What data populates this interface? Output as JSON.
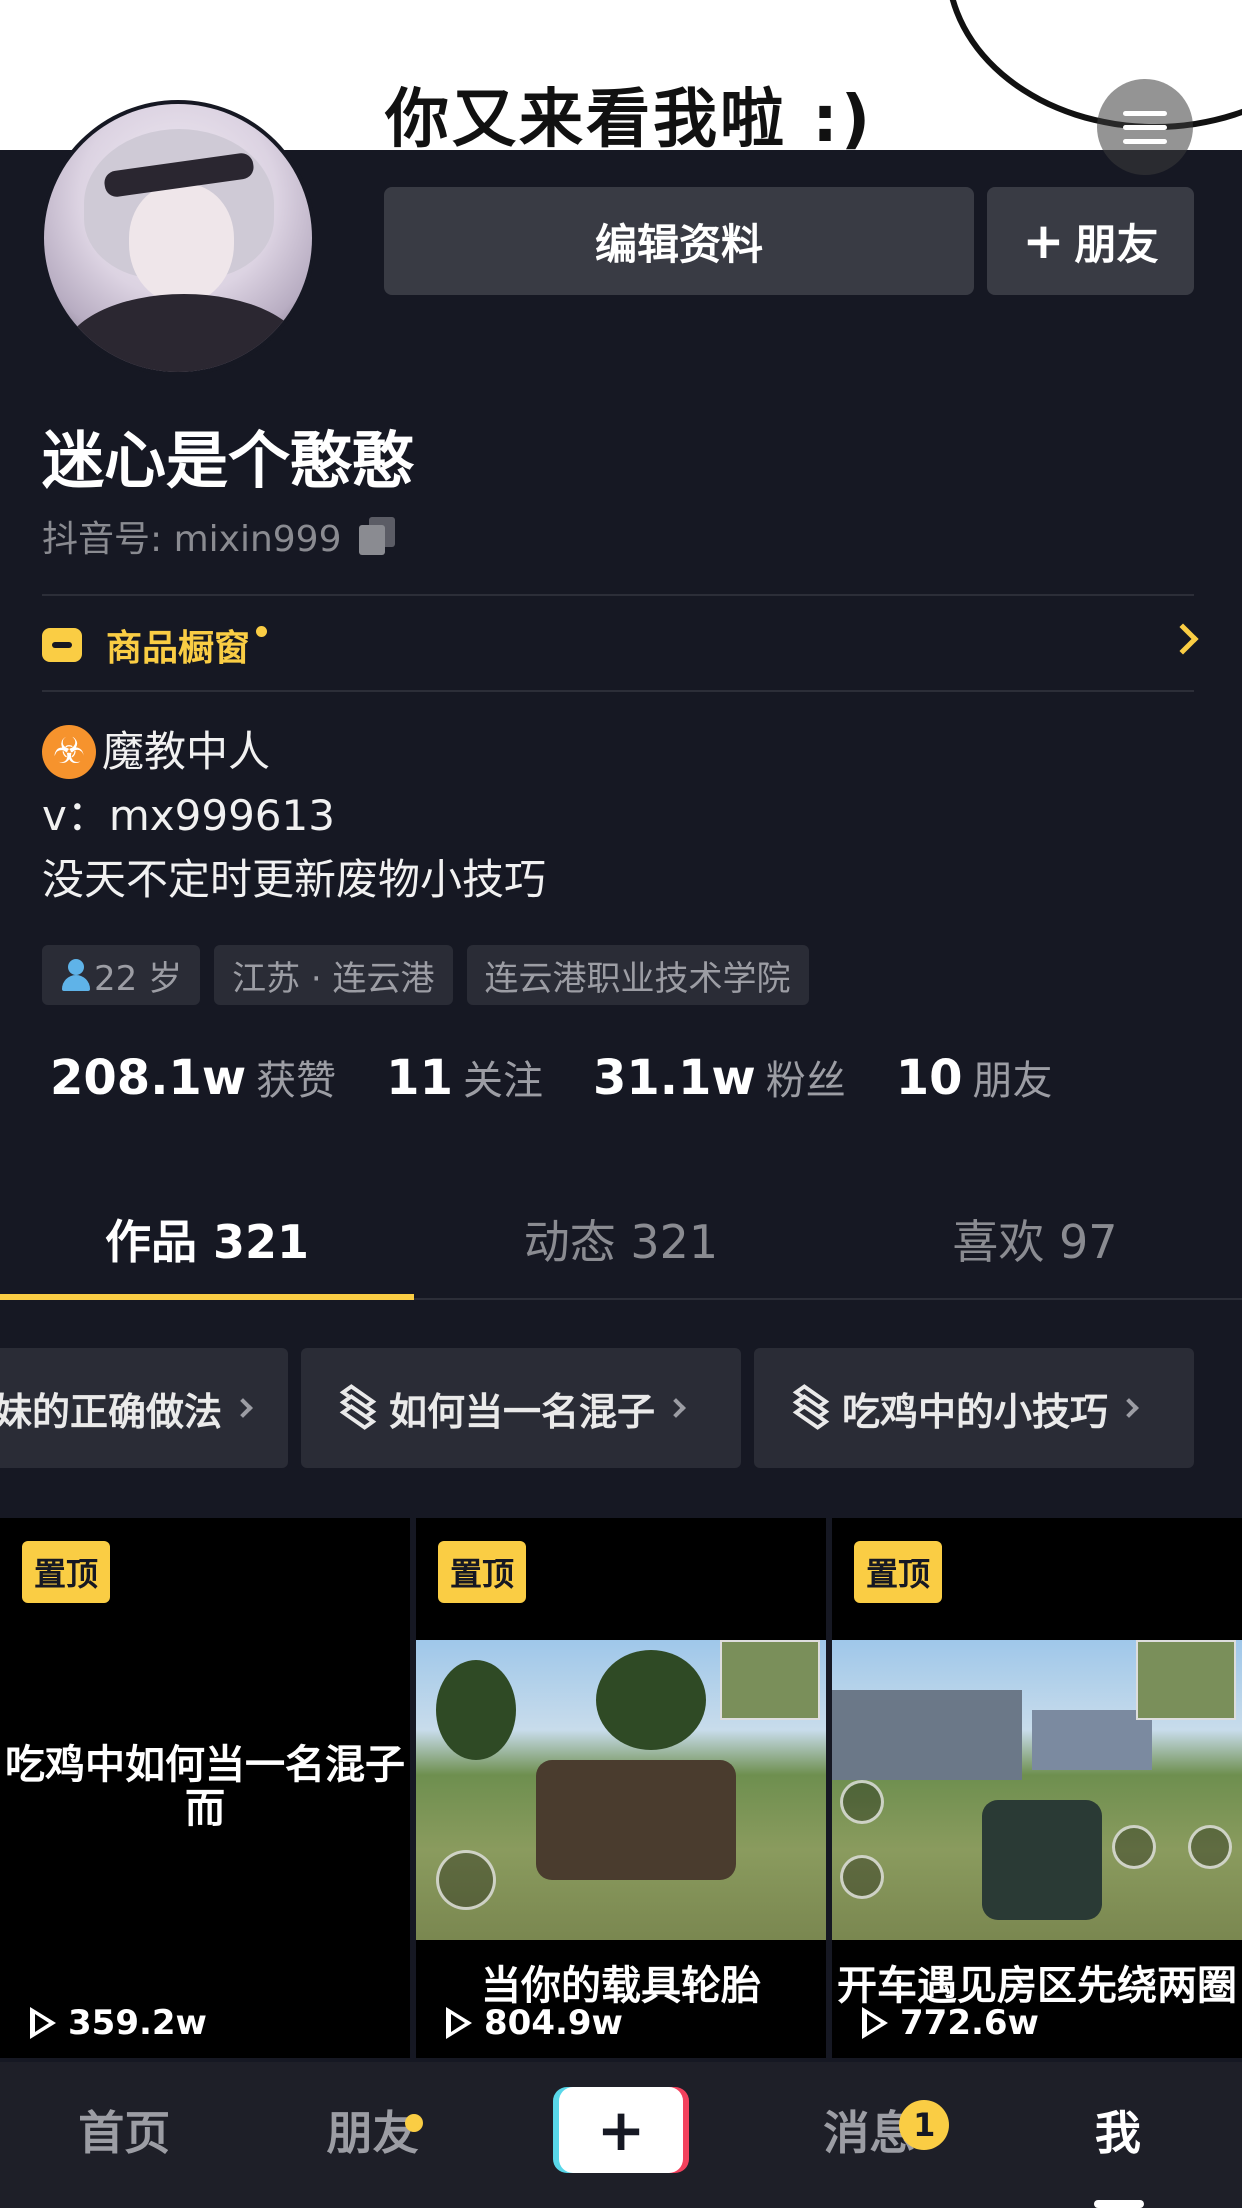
{
  "banner": {
    "text": "你又来看我啦 :)"
  },
  "profile": {
    "edit_label": "编辑资料",
    "add_friend_label": "朋友",
    "name": "迷心是个憨憨",
    "douyin_id": "抖音号: mixin999"
  },
  "shop": {
    "label": "商品橱窗"
  },
  "bio": {
    "line1": "魔教中人",
    "line2": "v：mx999613",
    "line3": "没天不定时更新废物小技巧"
  },
  "tags": [
    "22 岁",
    "江苏 · 连云港",
    "连云港职业技术学院"
  ],
  "stats": [
    {
      "num": "208.1w",
      "label": "获赞"
    },
    {
      "num": "11",
      "label": "关注"
    },
    {
      "num": "31.1w",
      "label": "粉丝"
    },
    {
      "num": "10",
      "label": "朋友"
    }
  ],
  "tabs": [
    "作品 321",
    "动态 321",
    "喜欢 97"
  ],
  "collections": [
    "妹的正确做法",
    "如何当一名混子",
    "吃鸡中的小技巧"
  ],
  "videos": [
    {
      "pin": "置顶",
      "caption": "吃鸡中如何当一名混子而",
      "plays": "359.2w"
    },
    {
      "pin": "置顶",
      "caption": "当你的载具轮胎",
      "plays": "804.9w"
    },
    {
      "pin": "置顶",
      "caption": "开车遇见房区先绕两圈",
      "plays": "772.6w"
    }
  ],
  "nav": {
    "home": "首页",
    "friends": "朋友",
    "create": "+",
    "messages": "消息",
    "messages_badge": "1",
    "me": "我"
  },
  "colors": {
    "accent": "#facd44",
    "background": "#161823"
  }
}
